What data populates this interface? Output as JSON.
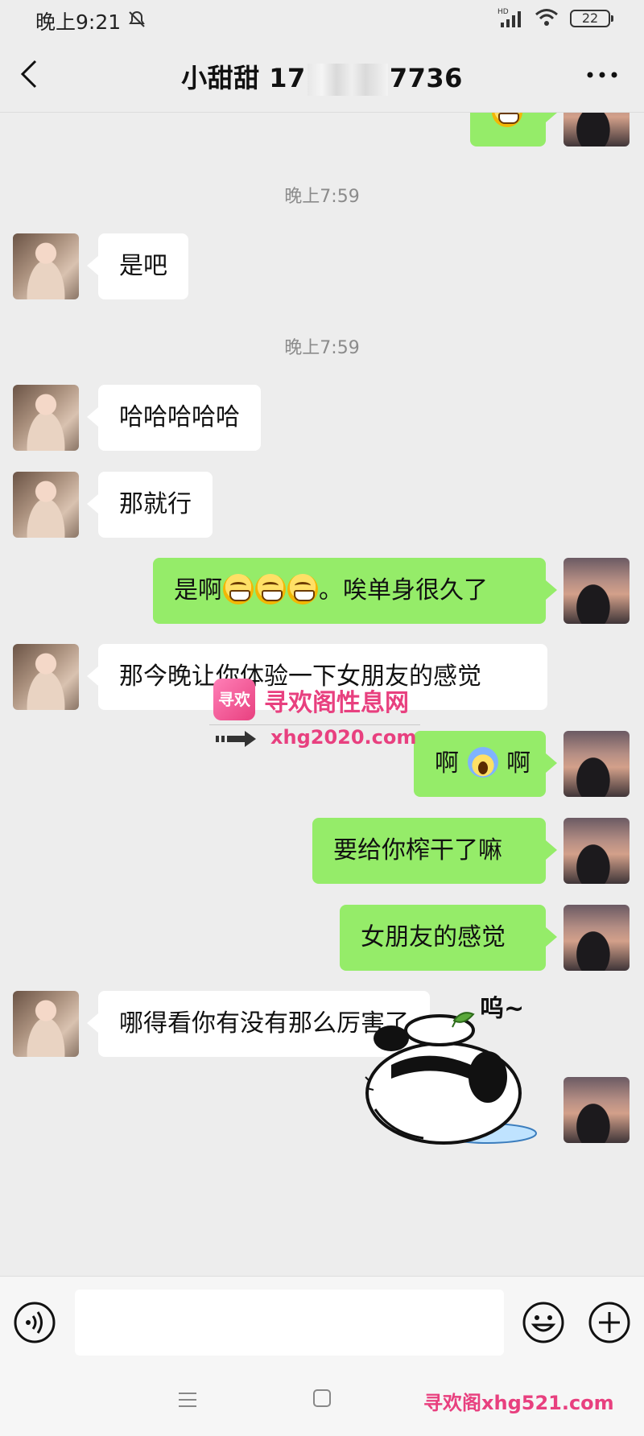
{
  "status_bar": {
    "time": "晚上9:21",
    "battery": "22"
  },
  "header": {
    "name_prefix": "小甜甜 17",
    "name_suffix": "7736"
  },
  "messages": [
    {
      "type": "timestamp",
      "text": "晚上7:59"
    },
    {
      "from": "her",
      "text": "是吧"
    },
    {
      "type": "timestamp",
      "text": "晚上7:59"
    },
    {
      "from": "her",
      "text": "哈哈哈哈哈"
    },
    {
      "from": "her",
      "text": "那就行"
    },
    {
      "from": "me",
      "text_before": "是啊",
      "emojis": [
        "grin",
        "grin",
        "grin"
      ],
      "text_after": "。唉单身很久了"
    },
    {
      "from": "her",
      "text": "那今晚让你体验一下女朋友的感觉"
    },
    {
      "from": "me",
      "text_before": "啊",
      "emojis": [
        "scream"
      ],
      "text_after": "啊"
    },
    {
      "from": "me",
      "text": "要给你榨干了嘛"
    },
    {
      "from": "me",
      "text": "女朋友的感觉"
    },
    {
      "from": "her",
      "text": "哪得看你有没有那么厉害了"
    },
    {
      "from": "me",
      "type": "sticker",
      "sticker_text": "呜~"
    }
  ],
  "watermark": {
    "logo": "寻欢",
    "title": "寻欢阁性息网",
    "url": "xhg2020.com",
    "footer": "寻欢阁xhg521.com"
  },
  "colors": {
    "sent_bubble": "#95ec69",
    "received_bubble": "#ffffff",
    "background": "#ededed",
    "watermark": "#e8407f"
  }
}
